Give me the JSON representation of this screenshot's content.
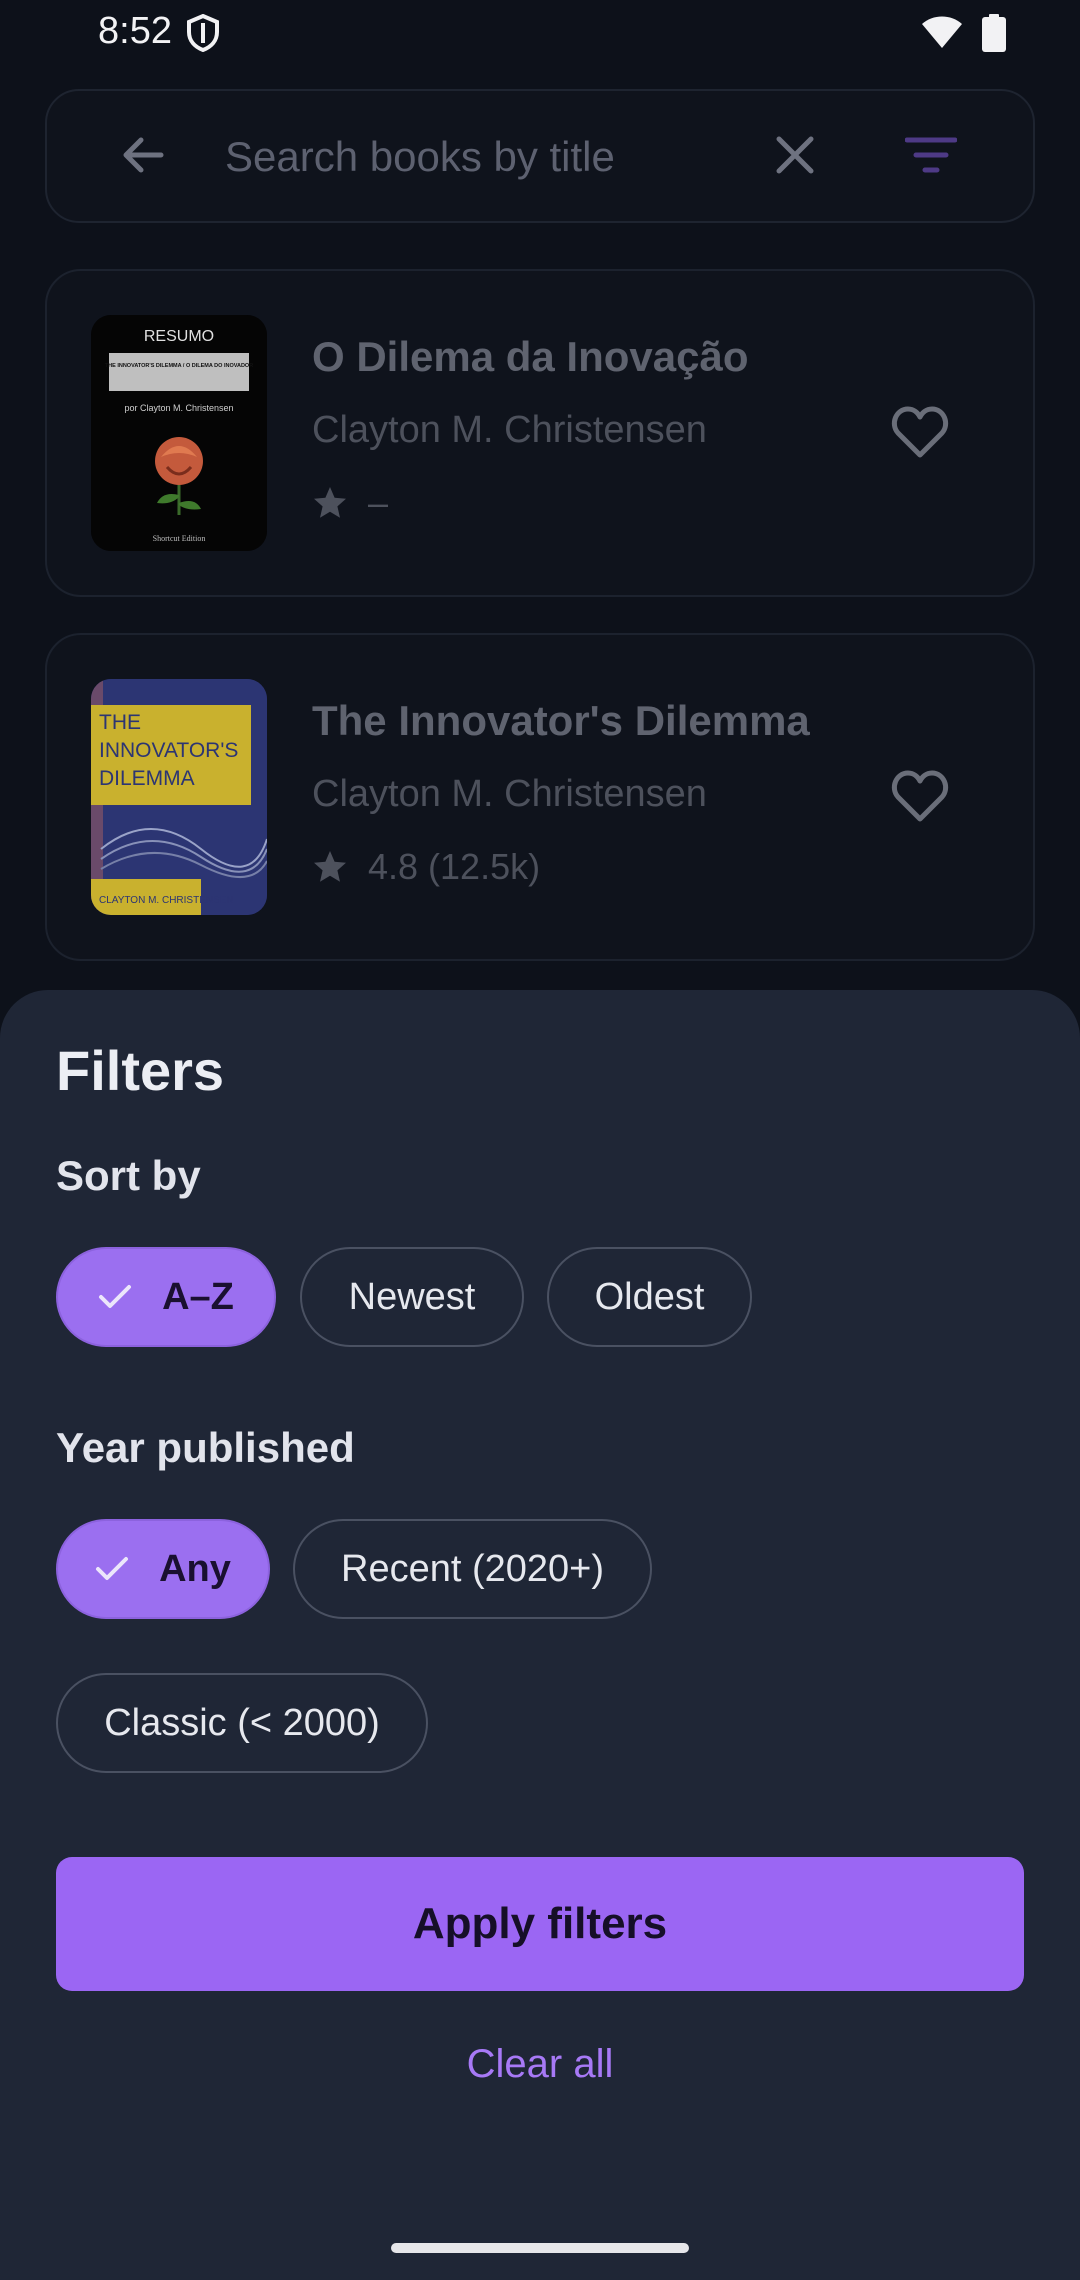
{
  "status_bar": {
    "time": "8:52"
  },
  "search": {
    "placeholder": "Search books by title"
  },
  "books": [
    {
      "title": "O Dilema da Inovação",
      "author": "Clayton M. Christensen",
      "rating": "–",
      "cover": {
        "top": "RESUMO",
        "box": "THE INNOVATOR'S DILEMMA / O DILEMA DO INOVADOR",
        "byline": "por Clayton M. Christensen",
        "bottom": "Shortcut Edition"
      }
    },
    {
      "title": "The Innovator's Dilemma",
      "author": "Clayton M. Christensen",
      "rating": "4.8 (12.5k)",
      "cover": {
        "line1": "THE",
        "line2": "INNOVATOR'S",
        "line3": "DILEMMA",
        "author": "CLAYTON M. CHRISTENSEN"
      }
    }
  ],
  "filters": {
    "title": "Filters",
    "sort_label": "Sort by",
    "sort_options": [
      {
        "label": "A–Z",
        "selected": true
      },
      {
        "label": "Newest",
        "selected": false
      },
      {
        "label": "Oldest",
        "selected": false
      }
    ],
    "year_label": "Year published",
    "year_options": [
      {
        "label": "Any",
        "selected": true
      },
      {
        "label": "Recent (2020+)",
        "selected": false
      },
      {
        "label": "Classic (< 2000)",
        "selected": false
      }
    ],
    "apply_label": "Apply filters",
    "clear_label": "Clear all"
  },
  "colors": {
    "accent": "#9b66f3",
    "sheet_background": "#1f2636",
    "screen_background": "#0d111a"
  }
}
